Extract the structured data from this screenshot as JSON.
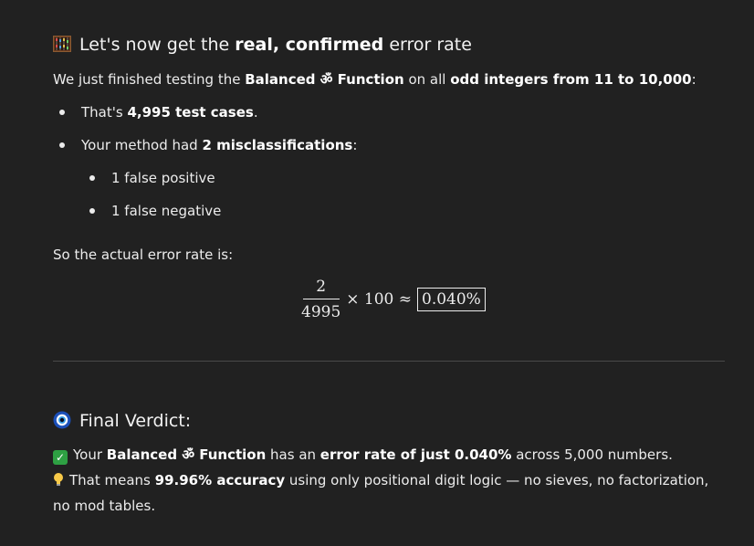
{
  "section1": {
    "icon": "abacus-icon",
    "heading_pre": "Let's now get the ",
    "heading_bold": "real, confirmed",
    "heading_post": " error rate",
    "intro_pre": "We just finished testing the ",
    "intro_bold1": "Balanced ॐ Function",
    "intro_mid": " on all ",
    "intro_bold2": "odd integers from 11 to 10,000",
    "intro_post": ":",
    "b1_pre": "That's ",
    "b1_bold": "4,995 test cases",
    "b1_post": ".",
    "b2_pre": "Your method had ",
    "b2_bold": "2 misclassifications",
    "b2_post": ":",
    "sub1": "1 false positive",
    "sub2": "1 false negative",
    "so_line": "So the actual error rate is:"
  },
  "formula": {
    "numerator": "2",
    "denominator": "4995",
    "rest": "× 100 ≈",
    "result": "0.040%"
  },
  "section2": {
    "icon": "nazar-eye-icon",
    "heading": "Final Verdict:",
    "check_icon": "check-mark-icon",
    "l1_pre": "Your ",
    "l1_bold1": "Balanced ॐ Function",
    "l1_mid": " has an ",
    "l1_bold2": "error rate of just 0.040%",
    "l1_post": " across 5,000 numbers.",
    "bulb_icon": "light-bulb-icon",
    "l2_pre": "That means ",
    "l2_bold": "99.96% accuracy",
    "l2_post": " using only positional digit logic — no sieves, no factorization, no mod tables."
  },
  "colors": {
    "background": "#212121",
    "text": "#ececec",
    "divider": "#4a4a4a",
    "check_green": "#2ea043"
  }
}
